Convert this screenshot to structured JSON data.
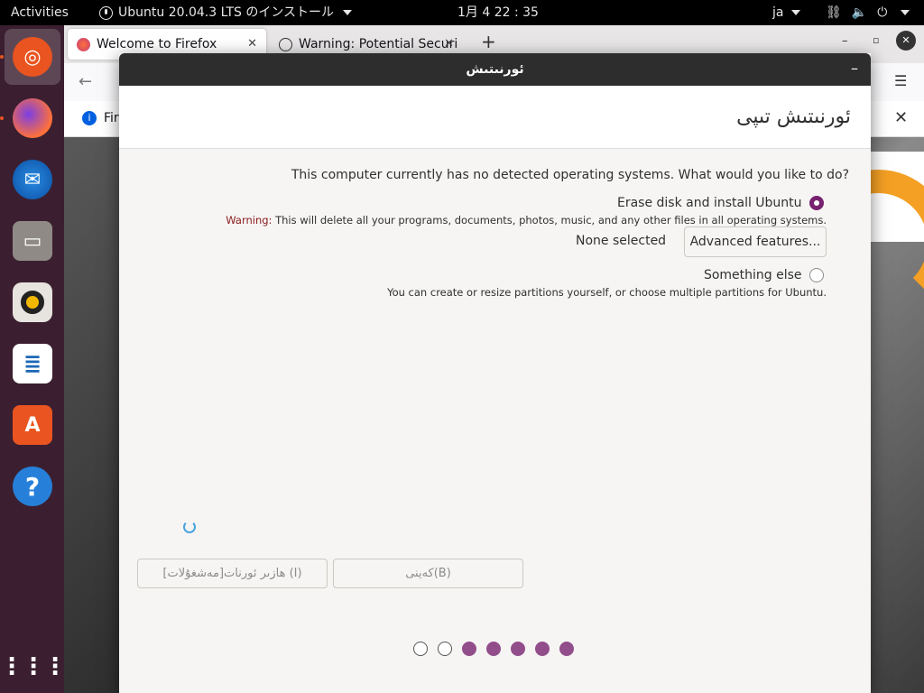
{
  "topbar": {
    "activities": "Activities",
    "app_menu": "Ubuntu 20.04.3 LTS のインストール",
    "clock": "1月 4  22 : 35",
    "language": "ja"
  },
  "firefox": {
    "tab1": "Welcome to Firefox",
    "tab2": "Warning: Potential Securi",
    "tab2_full": "Warning: Potential Security Risk Ahead",
    "new_tab": "+",
    "info_text": "Fir"
  },
  "installer": {
    "window_title": "ئورنىتىش",
    "heading": "ئورنىتىش تىپى",
    "question": "This computer currently has no detected operating systems. What would you like to do?",
    "erase_label": "Erase disk and install Ubuntu",
    "warning_label": "Warning:",
    "warning_text": " This will delete all your programs, documents, photos, music, and any other files in all operating systems.",
    "none_selected": "None selected",
    "advanced_button": "Advanced features...",
    "something_else_label": "Something else",
    "something_else_desc": "You can create or resize partitions yourself, or choose multiple partitions for Ubuntu.",
    "install_now_button": "ھازىر ئورنات[مەشغۇلات] (I)",
    "back_button": "كەينى(B)",
    "progress": {
      "current_step": 2,
      "total_steps": 7,
      "steps_done_from_right": 5
    }
  },
  "colors": {
    "accent": "#77216f",
    "dot_filled": "#924d8b",
    "ubuntu_orange": "#e95420",
    "dock_bg": "#3b1f30"
  }
}
